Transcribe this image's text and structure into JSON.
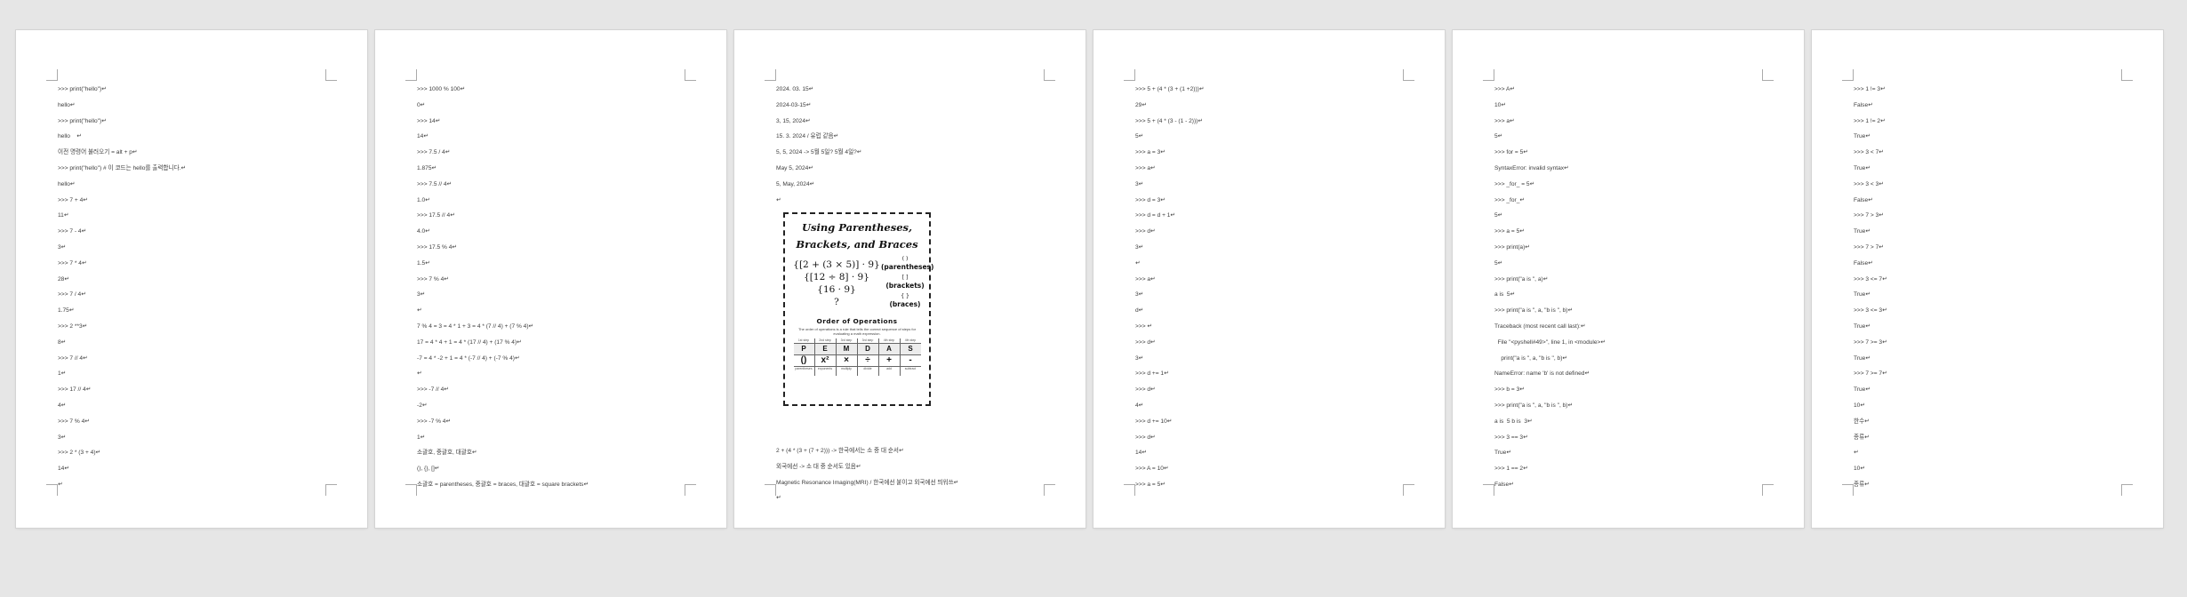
{
  "pages": [
    {
      "lines": [
        ">>> print(\"hello\")↵",
        "hello↵",
        ">>> print(\"hello\")↵",
        "hello    ↵",
        "이전 명령어 불러오기 = alt + p↵",
        ">>> print(\"hello\") # 이 코드는 hello를 출력합니다.↵",
        "hello↵",
        ">>> 7 + 4↵",
        "11↵",
        ">>> 7 - 4↵",
        "3↵",
        ">>> 7 * 4↵",
        "28↵",
        ">>> 7 / 4↵",
        "1.75↵",
        ">>> 2 **3↵",
        "8↵",
        ">>> 7 // 4↵",
        "1↵",
        ">>> 17 // 4↵",
        "4↵",
        ">>> 7 % 4↵",
        "3↵",
        ">>> 2 * (3 + 4)↵",
        "14↵",
        "↵"
      ]
    },
    {
      "lines": [
        ">>> 1000 % 100↵",
        "0↵",
        ">>> 14↵",
        "14↵",
        ">>> 7.5 / 4↵",
        "1.875↵",
        ">>> 7.5 // 4↵",
        "1.0↵",
        ">>> 17.5 // 4↵",
        "4.0↵",
        ">>> 17.5 % 4↵",
        "1.5↵",
        ">>> 7 % 4↵",
        "3↵",
        "↵",
        "7 % 4 = 3 = 4 * 1 + 3 = 4 * (7 // 4) + (7 % 4)↵",
        "17 = 4 * 4 + 1 = 4 * (17 // 4) + (17 % 4)↵",
        "-7 = 4 * -2 + 1 = 4 * (-7 // 4) + (-7 % 4)↵",
        "↵",
        ">>> -7 // 4↵",
        "-2↵",
        ">>> -7 % 4↵",
        "1↵",
        "소괄호, 중괄호, 대괄호↵",
        "(), {}, []↵",
        "소괄호 = parentheses, 중괄호 = braces, 대괄호 = square brackets↵"
      ]
    },
    {
      "lines": [
        "2024. 03. 15↵",
        "2024-03-15↵",
        "3, 15, 2024↵",
        "15. 3. 2024 / 유럽 같음↵",
        "5, 5, 2024 -> 5월 5일? 5월 4일?↵",
        "May 5, 2024↵",
        "5, May, 2024↵",
        "↵"
      ],
      "figure": {
        "title_line1": "Using Parentheses,",
        "title_line2": "Brackets, and Braces",
        "expr_line1": "{[2 + (3 × 5)] · 9}",
        "expr_line2": "{[12 ÷ 8] · 9}",
        "expr_line3": "{16 · 9}",
        "expr_line4": "?",
        "legend": [
          {
            "sym": "( )",
            "name": "(parentheses)"
          },
          {
            "sym": "[ ]",
            "name": "(brackets)"
          },
          {
            "sym": "{ }",
            "name": "(braces)"
          }
        ],
        "section_title": "Order of Operations",
        "section_sub": "The order of operations is a rule that tells the correct sequence of steps for evaluating a math expression.",
        "columns": [
          {
            "hdr": "1st step",
            "letter": "P",
            "sym": "()",
            "desc": "parentheses"
          },
          {
            "hdr": "2nd step",
            "letter": "E",
            "sym": "x²",
            "desc": "exponents"
          },
          {
            "hdr": "3rd step",
            "letter": "M",
            "sym": "×",
            "desc": "multiply"
          },
          {
            "hdr": "3rd step",
            "letter": "D",
            "sym": "÷",
            "desc": "divide"
          },
          {
            "hdr": "4th step",
            "letter": "A",
            "sym": "+",
            "desc": "add"
          },
          {
            "hdr": "4th step",
            "letter": "S",
            "sym": "-",
            "desc": "subtract"
          }
        ]
      },
      "lines_after": [
        "2 + (4 * (3 + (7 + 2))) -> 한국에서는 소 중 대 순서↵",
        "외국에선 -> 소 대 중 순서도 있음↵",
        "Magnetic Resonance Imaging(MRI) / 한국에선 붙이고 외국에선 띄워쓰↵",
        "↵"
      ]
    },
    {
      "lines": [
        ">>> 5 + (4 * (3 + (1 +2)))↵",
        "29↵",
        ">>> 5 + (4 * (3 - (1 - 2)))↵",
        "5↵",
        ">>> a = 3↵",
        ">>> a↵",
        "3↵",
        ">>> d = 3↵",
        ">>> d = d + 1↵",
        ">>> d↵",
        "3↵",
        "↵",
        ">>> a↵",
        "3↵",
        "d↵",
        ">>> ↵",
        ">>> d↵",
        "3↵",
        ">>> d += 1↵",
        ">>> d↵",
        "4↵",
        ">>> d += 10↵",
        ">>> d↵",
        "14↵",
        ">>> A = 10↵",
        ">>> a = 5↵"
      ]
    },
    {
      "lines": [
        ">>> A↵",
        "10↵",
        ">>> a↵",
        "5↵",
        ">>> for = 5↵",
        "SyntaxError: invalid syntax↵",
        ">>> _for_ = 5↵",
        ">>> _for_↵",
        "5↵",
        ">>> a = 5↵",
        ">>> print(a)↵",
        "5↵",
        ">>> print(\"a is \", a)↵",
        "a is  5↵",
        ">>> print(\"a is \", a, \"b is \", b)↵",
        "Traceback (most recent call last):↵",
        "  File \"<pyshell#49>\", line 1, in <module>↵",
        "    print(\"a is \", a, \"b is \", b)↵",
        "NameError: name 'b' is not defined↵",
        ">>> b = 3↵",
        ">>> print(\"a is \", a, \"b is \", b)↵",
        "a is  5 b is  3↵",
        ">>> 3 == 3↵",
        "True↵",
        ">>> 1 == 2↵",
        "False↵"
      ]
    },
    {
      "lines": [
        ">>> 1 != 3↵",
        "False↵",
        ">>> 1 != 2↵",
        "True↵",
        ">>> 3 < 7↵",
        "True↵",
        ">>> 3 < 3↵",
        "False↵",
        ">>> 7 > 3↵",
        "True↵",
        ">>> 7 > 7↵",
        "False↵",
        ">>> 3 <= 7↵",
        "True↵",
        ">>> 3 <= 3↵",
        "True↵",
        ">>> 7 >= 3↵",
        "True↵",
        ">>> 7 >= 7↵",
        "True↵",
        "10↵",
        "한수↵",
        "종류↵",
        "↵",
        "10↵",
        "종류↵"
      ]
    }
  ]
}
